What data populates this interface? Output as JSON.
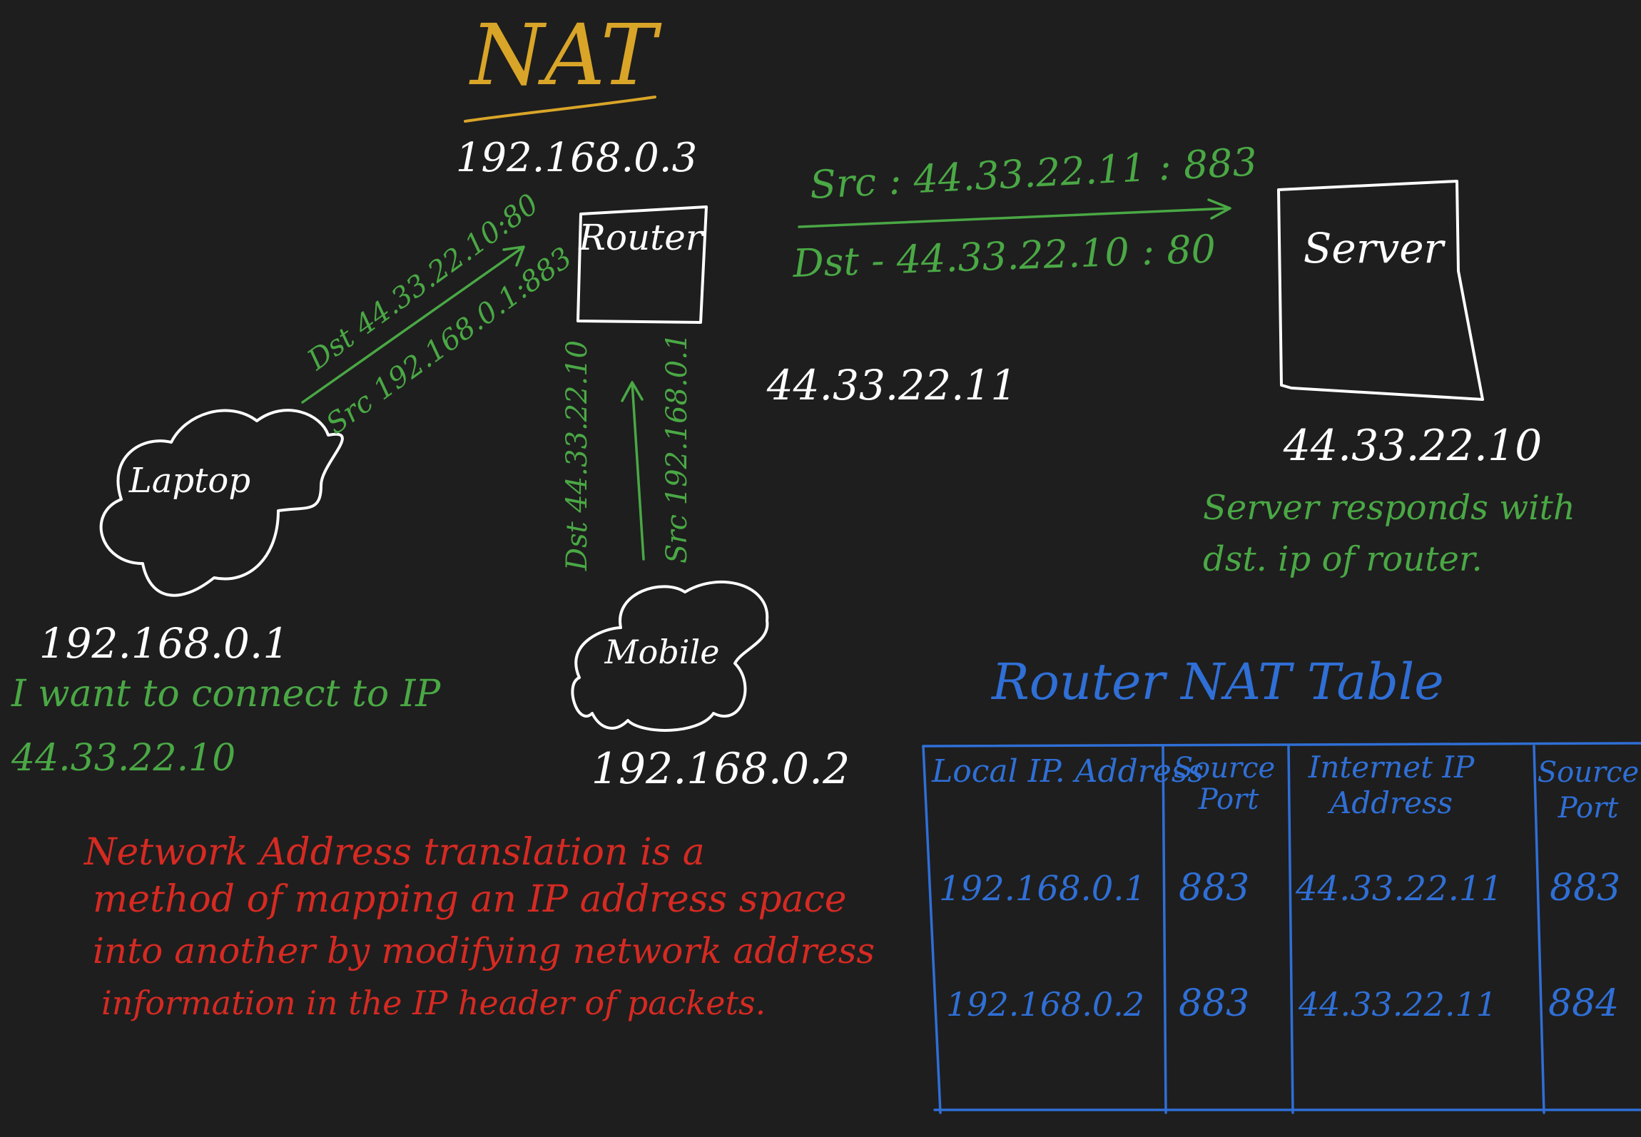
{
  "title": "NAT",
  "router": {
    "label": "Router",
    "ip": "192.168.0.3",
    "public_ip": "44.33.22.11"
  },
  "server": {
    "label": "Server",
    "ip": "44.33.22.10",
    "note": [
      "Server responds with",
      "dst. ip of router."
    ]
  },
  "laptop": {
    "label": "Laptop",
    "ip": "192.168.0.1",
    "note": [
      "I want to connect to IP",
      "44.33.22.10"
    ]
  },
  "mobile": {
    "label": "Mobile",
    "ip": "192.168.0.2"
  },
  "arrows": {
    "laptop_to_router": {
      "dst": "Dst 44.33.22.10:80",
      "src": "Src 192.168.0.1:883"
    },
    "mobile_to_router": {
      "dst": "Dst 44.33.22.10",
      "src": "Src 192.168.0.1"
    },
    "router_to_server": {
      "src": "Src : 44.33.22.11 : 883",
      "dst": "Dst - 44.33.22.10 : 80"
    }
  },
  "definition": [
    "Network Address translation is a",
    "method of mapping an IP address space",
    "into another by modifying network address",
    "information in the IP header of packets."
  ],
  "nat_table": {
    "title": "Router NAT Table",
    "headers": [
      [
        "Local IP. Address"
      ],
      [
        "Source",
        "Port"
      ],
      [
        "Internet IP",
        "Address"
      ],
      [
        "Source",
        "Port"
      ]
    ],
    "rows": [
      [
        "192.168.0.1",
        "883",
        "44.33.22.11",
        "883"
      ],
      [
        "192.168.0.2",
        "883",
        "44.33.22.11",
        "884"
      ]
    ]
  },
  "colors": {
    "background": "#1e1e1e",
    "white": "#ffffff",
    "gold": "#d9a528",
    "green": "#4aa845",
    "red": "#d62a22",
    "blue": "#2f6fd6"
  }
}
